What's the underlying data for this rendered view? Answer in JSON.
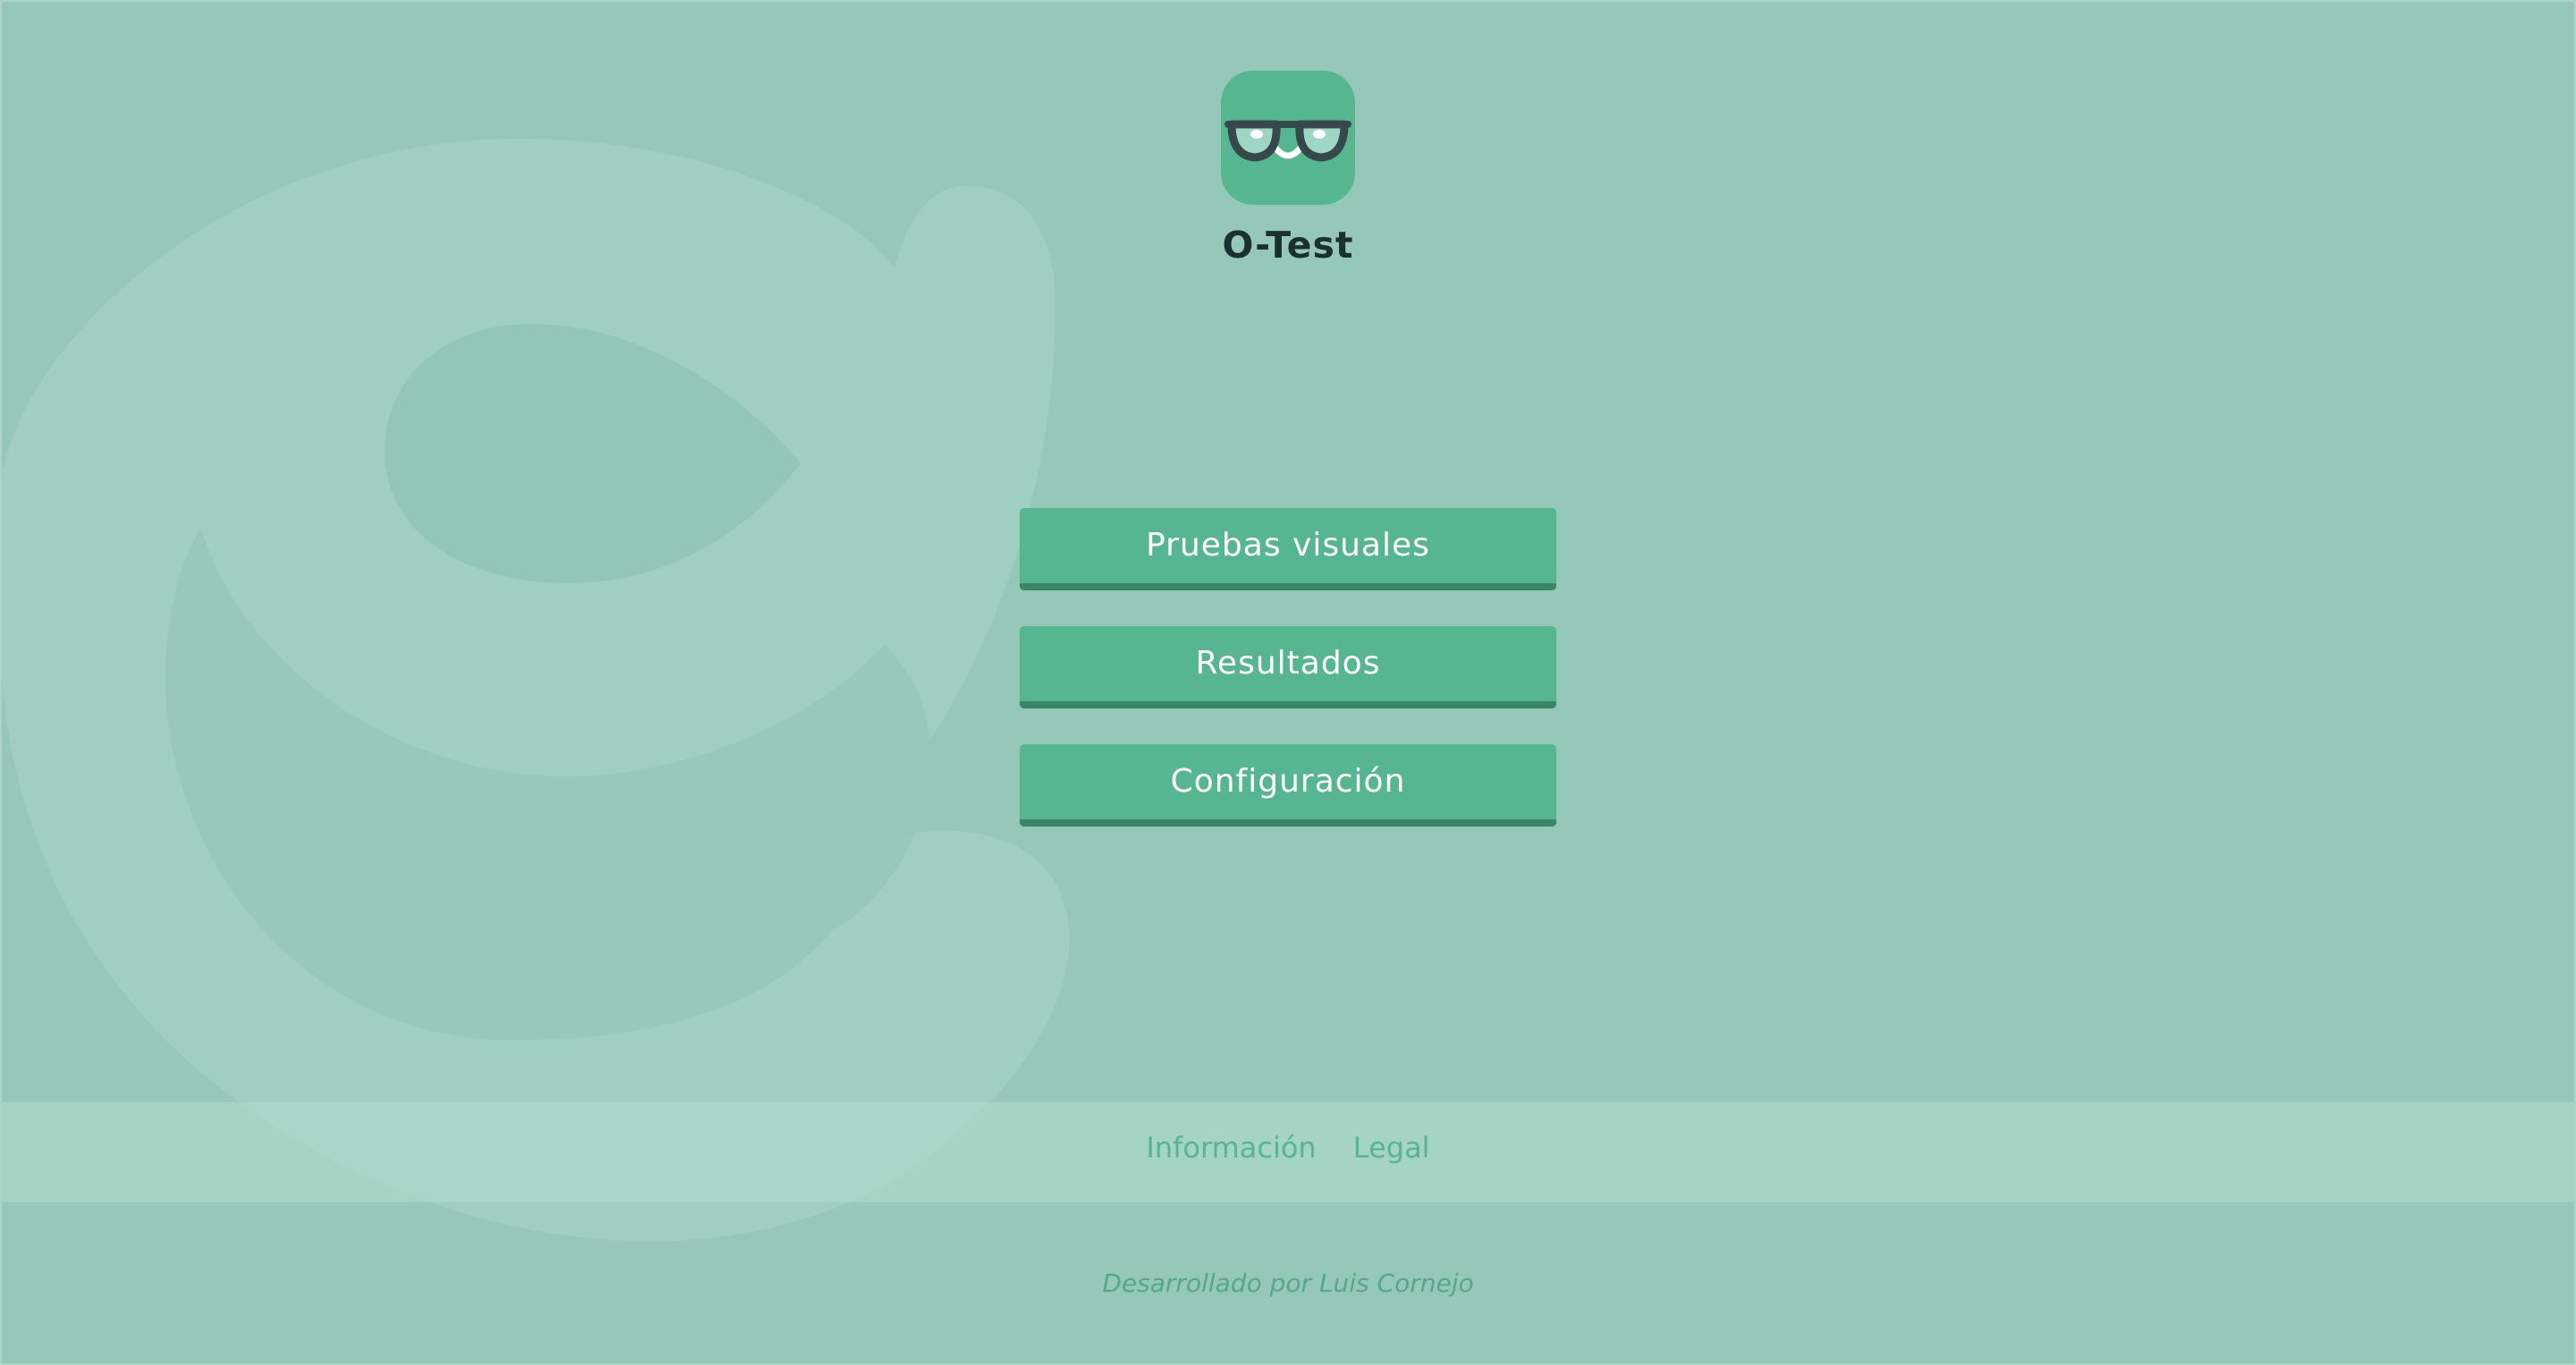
{
  "app": {
    "title": "O-Test",
    "logo_icon": "glasses-smile-icon",
    "brand_color": "#56b690",
    "background_color": "#95c8b8"
  },
  "menu": {
    "items": [
      {
        "label": "Pruebas visuales"
      },
      {
        "label": "Resultados"
      },
      {
        "label": "Configuración"
      }
    ]
  },
  "footer": {
    "links": [
      {
        "label": "Información"
      },
      {
        "label": "Legal"
      }
    ],
    "credits": "Desarrollado por Luis Cornejo"
  }
}
